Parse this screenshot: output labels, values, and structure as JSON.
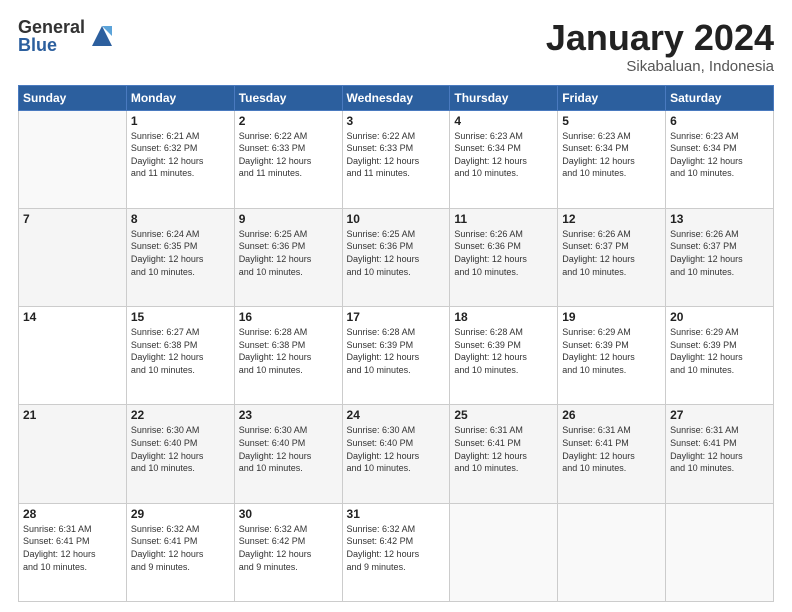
{
  "header": {
    "logo_general": "General",
    "logo_blue": "Blue",
    "month_title": "January 2024",
    "location": "Sikabaluan, Indonesia"
  },
  "days_of_week": [
    "Sunday",
    "Monday",
    "Tuesday",
    "Wednesday",
    "Thursday",
    "Friday",
    "Saturday"
  ],
  "weeks": [
    [
      {
        "day": "",
        "info": ""
      },
      {
        "day": "1",
        "info": "Sunrise: 6:21 AM\nSunset: 6:32 PM\nDaylight: 12 hours\nand 11 minutes."
      },
      {
        "day": "2",
        "info": "Sunrise: 6:22 AM\nSunset: 6:33 PM\nDaylight: 12 hours\nand 11 minutes."
      },
      {
        "day": "3",
        "info": "Sunrise: 6:22 AM\nSunset: 6:33 PM\nDaylight: 12 hours\nand 11 minutes."
      },
      {
        "day": "4",
        "info": "Sunrise: 6:23 AM\nSunset: 6:34 PM\nDaylight: 12 hours\nand 10 minutes."
      },
      {
        "day": "5",
        "info": "Sunrise: 6:23 AM\nSunset: 6:34 PM\nDaylight: 12 hours\nand 10 minutes."
      },
      {
        "day": "6",
        "info": "Sunrise: 6:23 AM\nSunset: 6:34 PM\nDaylight: 12 hours\nand 10 minutes."
      }
    ],
    [
      {
        "day": "7",
        "info": ""
      },
      {
        "day": "8",
        "info": "Sunrise: 6:24 AM\nSunset: 6:35 PM\nDaylight: 12 hours\nand 10 minutes."
      },
      {
        "day": "9",
        "info": "Sunrise: 6:25 AM\nSunset: 6:36 PM\nDaylight: 12 hours\nand 10 minutes."
      },
      {
        "day": "10",
        "info": "Sunrise: 6:25 AM\nSunset: 6:36 PM\nDaylight: 12 hours\nand 10 minutes."
      },
      {
        "day": "11",
        "info": "Sunrise: 6:26 AM\nSunset: 6:36 PM\nDaylight: 12 hours\nand 10 minutes."
      },
      {
        "day": "12",
        "info": "Sunrise: 6:26 AM\nSunset: 6:37 PM\nDaylight: 12 hours\nand 10 minutes."
      },
      {
        "day": "13",
        "info": "Sunrise: 6:26 AM\nSunset: 6:37 PM\nDaylight: 12 hours\nand 10 minutes."
      }
    ],
    [
      {
        "day": "14",
        "info": ""
      },
      {
        "day": "15",
        "info": "Sunrise: 6:27 AM\nSunset: 6:38 PM\nDaylight: 12 hours\nand 10 minutes."
      },
      {
        "day": "16",
        "info": "Sunrise: 6:28 AM\nSunset: 6:38 PM\nDaylight: 12 hours\nand 10 minutes."
      },
      {
        "day": "17",
        "info": "Sunrise: 6:28 AM\nSunset: 6:39 PM\nDaylight: 12 hours\nand 10 minutes."
      },
      {
        "day": "18",
        "info": "Sunrise: 6:28 AM\nSunset: 6:39 PM\nDaylight: 12 hours\nand 10 minutes."
      },
      {
        "day": "19",
        "info": "Sunrise: 6:29 AM\nSunset: 6:39 PM\nDaylight: 12 hours\nand 10 minutes."
      },
      {
        "day": "20",
        "info": "Sunrise: 6:29 AM\nSunset: 6:39 PM\nDaylight: 12 hours\nand 10 minutes."
      }
    ],
    [
      {
        "day": "21",
        "info": ""
      },
      {
        "day": "22",
        "info": "Sunrise: 6:30 AM\nSunset: 6:40 PM\nDaylight: 12 hours\nand 10 minutes."
      },
      {
        "day": "23",
        "info": "Sunrise: 6:30 AM\nSunset: 6:40 PM\nDaylight: 12 hours\nand 10 minutes."
      },
      {
        "day": "24",
        "info": "Sunrise: 6:30 AM\nSunset: 6:40 PM\nDaylight: 12 hours\nand 10 minutes."
      },
      {
        "day": "25",
        "info": "Sunrise: 6:31 AM\nSunset: 6:41 PM\nDaylight: 12 hours\nand 10 minutes."
      },
      {
        "day": "26",
        "info": "Sunrise: 6:31 AM\nSunset: 6:41 PM\nDaylight: 12 hours\nand 10 minutes."
      },
      {
        "day": "27",
        "info": "Sunrise: 6:31 AM\nSunset: 6:41 PM\nDaylight: 12 hours\nand 10 minutes."
      }
    ],
    [
      {
        "day": "28",
        "info": "Sunrise: 6:31 AM\nSunset: 6:41 PM\nDaylight: 12 hours\nand 10 minutes."
      },
      {
        "day": "29",
        "info": "Sunrise: 6:32 AM\nSunset: 6:41 PM\nDaylight: 12 hours\nand 9 minutes."
      },
      {
        "day": "30",
        "info": "Sunrise: 6:32 AM\nSunset: 6:42 PM\nDaylight: 12 hours\nand 9 minutes."
      },
      {
        "day": "31",
        "info": "Sunrise: 6:32 AM\nSunset: 6:42 PM\nDaylight: 12 hours\nand 9 minutes."
      },
      {
        "day": "",
        "info": ""
      },
      {
        "day": "",
        "info": ""
      },
      {
        "day": "",
        "info": ""
      }
    ]
  ]
}
